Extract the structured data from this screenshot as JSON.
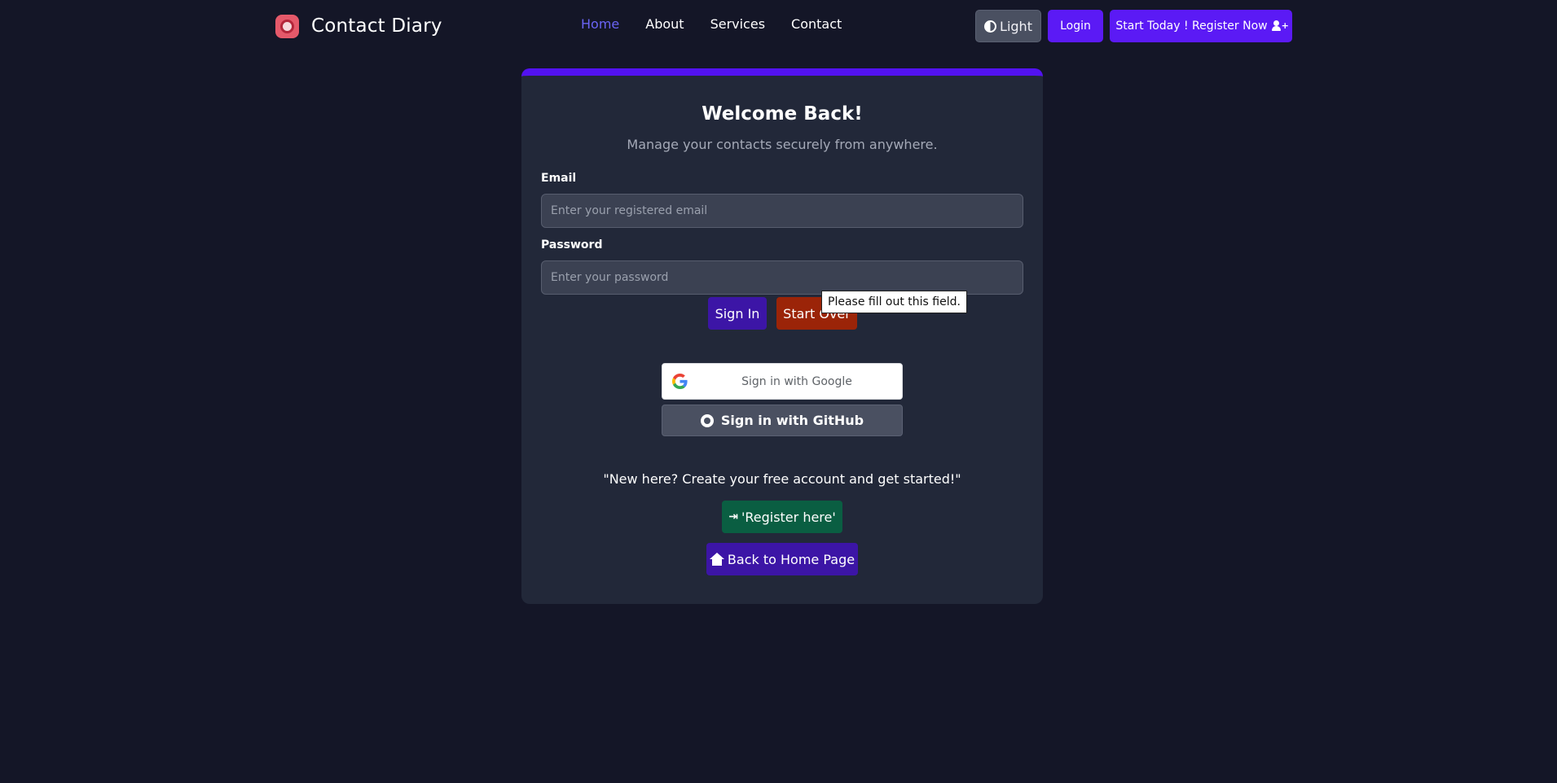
{
  "header": {
    "brand_name": "Contact Diary",
    "nav": [
      {
        "label": "Home",
        "active": true
      },
      {
        "label": "About",
        "active": false
      },
      {
        "label": "Services",
        "active": false
      },
      {
        "label": "Contact",
        "active": false
      }
    ],
    "theme_toggle_label": "Light",
    "login_label": "Login",
    "register_label": "Start Today ! Register Now"
  },
  "login_card": {
    "title": "Welcome Back!",
    "subtitle": "Manage your contacts securely from anywhere.",
    "email_label": "Email",
    "email_placeholder": "Enter your registered email",
    "email_value": "",
    "password_label": "Password",
    "password_placeholder": "Enter your password",
    "password_value": "",
    "signin_label": "Sign In",
    "startover_label": "Start Over",
    "google_label": "Sign in with Google",
    "github_label": "Sign in with GitHub",
    "new_here_text": "\"New here? Create your free account and get started!\"",
    "register_here_label": "'Register here'",
    "back_home_label": "Back to Home Page"
  },
  "tooltip": {
    "text": "Please fill out this field."
  },
  "colors": {
    "page_bg": "#141627",
    "card_bg": "#222839",
    "accent": "#5b1af5",
    "nav_active": "#6a64f5",
    "start_over": "#9b2408",
    "register_green": "#0a5e42"
  }
}
